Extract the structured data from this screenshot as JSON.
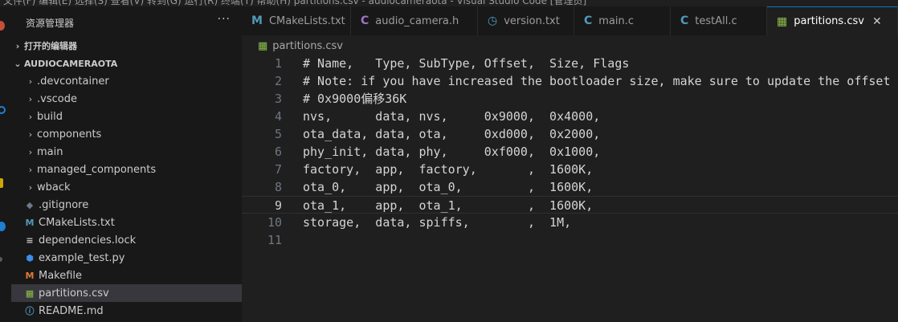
{
  "topbar": {
    "ghost_text": "文件(F)  编辑(E)  选择(S)  查看(V)  转到(G)  运行(R)  终端(T)  帮助(H)        partitions.csv - audiocameraota - Visual Studio Code [管理员]"
  },
  "sidebar": {
    "title": "资源管理器",
    "more": "···",
    "open_editors_label": "打开的编辑器",
    "project_label": "AUDIOCAMERAOTA",
    "items": [
      {
        "label": ".devcontainer",
        "type": "folder"
      },
      {
        "label": ".vscode",
        "type": "folder"
      },
      {
        "label": "build",
        "type": "folder"
      },
      {
        "label": "components",
        "type": "folder"
      },
      {
        "label": "main",
        "type": "folder"
      },
      {
        "label": "managed_components",
        "type": "folder"
      },
      {
        "label": "wback",
        "type": "folder"
      },
      {
        "label": ".gitignore",
        "type": "file",
        "icon": "git-diamond-icon",
        "color": "#6c7a89"
      },
      {
        "label": "CMakeLists.txt",
        "type": "file",
        "icon": "cmake-icon",
        "color": "#519aba"
      },
      {
        "label": "dependencies.lock",
        "type": "file",
        "icon": "lines-icon",
        "color": "#c5c5c5"
      },
      {
        "label": "example_test.py",
        "type": "file",
        "icon": "python-icon",
        "color": "#3b8eea"
      },
      {
        "label": "Makefile",
        "type": "file",
        "icon": "makefile-icon",
        "color": "#e37933"
      },
      {
        "label": "partitions.csv",
        "type": "file",
        "icon": "csv-table-icon",
        "color": "#8dc149",
        "selected": true
      },
      {
        "label": "README.md",
        "type": "file",
        "icon": "info-icon",
        "color": "#519aba"
      }
    ]
  },
  "tabs": [
    {
      "label": "CMakeLists.txt",
      "icon": "cmake-icon",
      "glyph": "M",
      "color": "#519aba"
    },
    {
      "label": "audio_camera.h",
      "icon": "c-header-icon",
      "glyph": "C",
      "color": "#a074c4"
    },
    {
      "label": "version.txt",
      "icon": "clock-icon",
      "glyph": "◷",
      "color": "#519aba"
    },
    {
      "label": "main.c",
      "icon": "c-file-icon",
      "glyph": "C",
      "color": "#519aba"
    },
    {
      "label": "testAll.c",
      "icon": "c-file-icon",
      "glyph": "C",
      "color": "#519aba"
    },
    {
      "label": "partitions.csv",
      "icon": "csv-table-icon",
      "glyph": "▦",
      "color": "#8dc149",
      "active": true
    }
  ],
  "breadcrumb": {
    "file": "partitions.csv"
  },
  "editor": {
    "current_line": 9,
    "lines": [
      "# Name,   Type, SubType, Offset,  Size, Flags",
      "# Note: if you have increased the bootloader size, make sure to update the offset",
      "# 0x9000偏移36K",
      "nvs,      data, nvs,     0x9000,  0x4000,",
      "ota_data, data, ota,     0xd000,  0x2000,",
      "phy_init, data, phy,     0xf000,  0x1000,",
      "factory,  app,  factory,       ,  1600K,",
      "ota_0,    app,  ota_0,         ,  1600K,",
      "ota_1,    app,  ota_1,         ,  1600K,",
      "storage,  data, spiffs,        ,  1M,",
      ""
    ]
  },
  "colors": {
    "accent": "#0078d4",
    "activity_red": "#c74e39",
    "activity_blue": "#1e7fd3",
    "activity_yellow": "#cca700"
  }
}
